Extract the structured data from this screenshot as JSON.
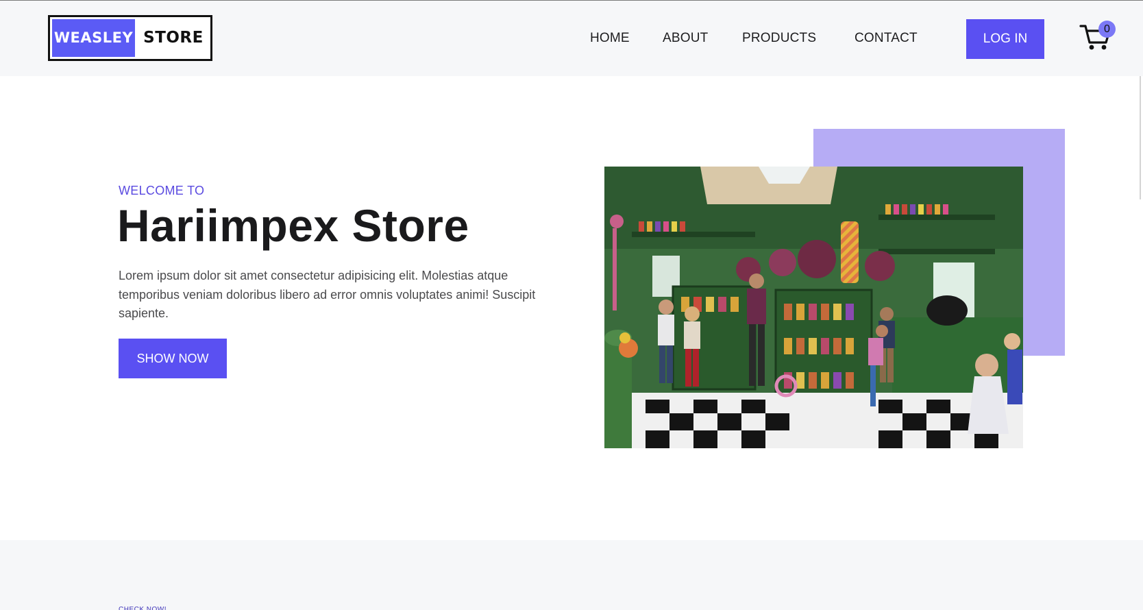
{
  "brand": {
    "logo_part1": "WEASLEY",
    "logo_part2": "STORE",
    "logo_colors": {
      "primary": "#5b5bf5",
      "border": "#111111"
    }
  },
  "nav": {
    "links": [
      "HOME",
      "ABOUT",
      "PRODUCTS",
      "CONTACT"
    ],
    "login_label": "LOG IN",
    "cart_icon": "shopping-cart-icon",
    "cart_count": "0"
  },
  "hero": {
    "eyebrow": "WELCOME TO",
    "title": "Hariimpex Store",
    "text": "Lorem ipsum dolor sit amet consectetur adipisicing elit. Molestias atque temporibus veniam doloribus libero ad error omnis voluptates animi! Suscipit sapiente.",
    "cta_label": "SHOW NOW",
    "image_subject": "candy-shop-photo"
  },
  "lower": {
    "eyebrow": "CHECK NOW!"
  },
  "colors": {
    "accent": "#5a50f2",
    "accent_light": "#b6acf5",
    "eyebrow": "#5a4ae0",
    "nav_bg": "#f6f7f9"
  }
}
